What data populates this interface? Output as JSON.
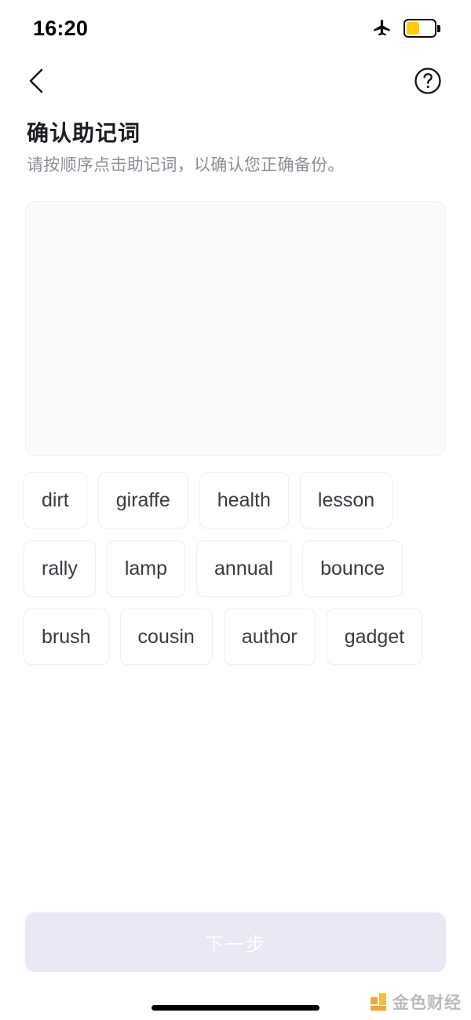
{
  "status_bar": {
    "time": "16:20",
    "airplane_icon": "airplane-mode-icon",
    "battery_icon": "battery-icon",
    "battery_color": "#FFCC00",
    "battery_level_percent": 45
  },
  "nav_bar": {
    "back_icon": "chevron-left-icon",
    "help_icon": "question-mark-circle-icon"
  },
  "header": {
    "title": "确认助记词",
    "subtitle": "请按顺序点击助记词，以确认您正确备份。"
  },
  "answer_area": {
    "selected_words": [],
    "placeholder": ""
  },
  "word_pool": {
    "words": [
      "dirt",
      "giraffe",
      "health",
      "lesson",
      "rally",
      "lamp",
      "annual",
      "bounce",
      "brush",
      "cousin",
      "author",
      "gadget"
    ]
  },
  "footer": {
    "next_label": "下一步",
    "next_disabled": true,
    "next_bg_color": "#E9E9F6",
    "next_text_color": "#FFFFFF"
  },
  "watermark": {
    "text": "金色财经",
    "logo_icon": "jinse-logo-icon",
    "logo_color": "#F0A020"
  }
}
